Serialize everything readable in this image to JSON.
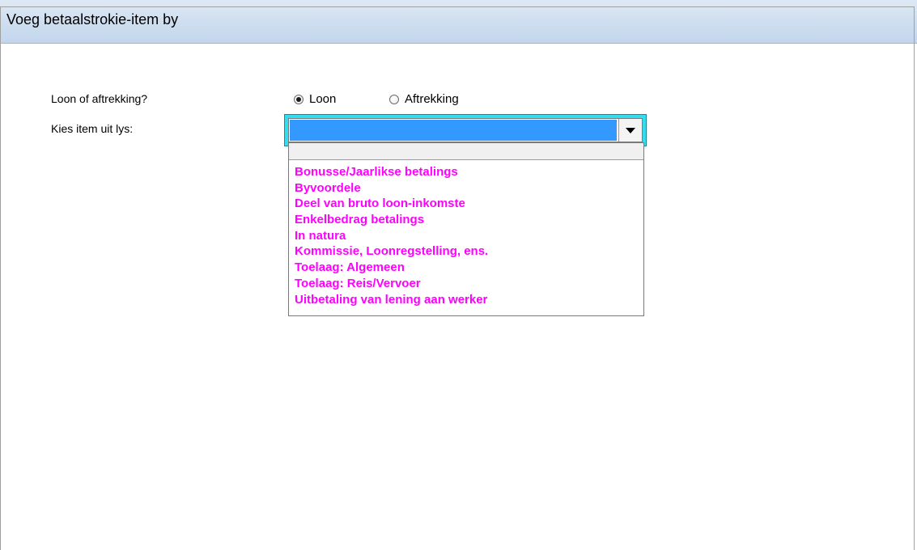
{
  "window": {
    "title": "Voeg betaalstrokie-item by"
  },
  "form": {
    "type_question": "Loon of aftrekking?",
    "radio_options": [
      {
        "label": "Loon",
        "checked": true
      },
      {
        "label": "Aftrekking",
        "checked": false
      }
    ],
    "item_label": "Kies item uit lys:",
    "combo_value": ""
  },
  "dropdown": {
    "items": [
      "Bonusse/Jaarlikse betalings",
      "Byvoordele",
      "Deel van bruto loon-inkomste",
      "Enkelbedrag betalings",
      "In natura",
      "Kommissie, Loonregstelling, ens.",
      "Toelaag: Algemeen",
      "Toelaag: Reis/Vervoer",
      "Uitbetaling van lening aan werker"
    ]
  },
  "colors": {
    "combo_highlight": "#3399ff",
    "combo_focus_frame": "#33ddee",
    "item_text": "#ff00ff"
  },
  "icons": {
    "combo_button": "chevron-down-icon"
  }
}
